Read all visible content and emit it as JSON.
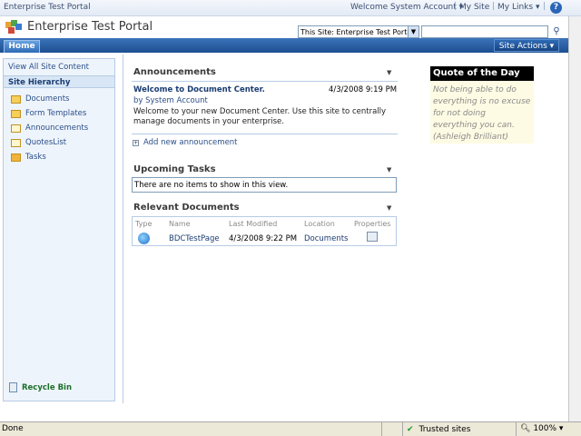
{
  "topbar": {
    "breadcrumb": "Enterprise Test Portal",
    "welcome": "Welcome System Account",
    "my_site": "My Site",
    "my_links": "My Links",
    "help_glyph": "?"
  },
  "header": {
    "site_title": "Enterprise Test Portal",
    "search_scope": "This Site: Enterprise Test Porta",
    "search_value": ""
  },
  "nav": {
    "home_tab": "Home",
    "site_actions": "Site Actions"
  },
  "left_nav": {
    "view_all": "View All Site Content",
    "hierarchy_header": "Site Hierarchy",
    "items": [
      {
        "label": "Documents",
        "icon": "library-icon"
      },
      {
        "label": "Form Templates",
        "icon": "library-icon"
      },
      {
        "label": "Announcements",
        "icon": "list-icon"
      },
      {
        "label": "QuotesList",
        "icon": "list-icon"
      },
      {
        "label": "Tasks",
        "icon": "task-icon"
      }
    ],
    "recycle_bin": "Recycle Bin"
  },
  "announcements": {
    "title": "Announcements",
    "item_title": "Welcome to Document Center.",
    "item_date": "4/3/2008 9:19 PM",
    "item_by": "by System Account",
    "item_body": "Welcome to your new Document Center. Use this site to centrally manage documents in your enterprise.",
    "add_new": "Add new announcement"
  },
  "tasks": {
    "title": "Upcoming Tasks",
    "empty_message": "There are no items to show in this view."
  },
  "documents": {
    "title": "Relevant Documents",
    "columns": [
      "Type",
      "Name",
      "Last Modified",
      "Location",
      "Properties"
    ],
    "rows": [
      {
        "name": "BDCTestPage",
        "modified": "4/3/2008 9:22 PM",
        "location": "Documents"
      }
    ]
  },
  "quote": {
    "title": "Quote of the Day",
    "text": "Not being able to do everything is no excuse for not doing everything you can. (Ashleigh Brilliant)"
  },
  "statusbar": {
    "status": "Done",
    "zone": "Trusted sites",
    "zoom": "100%"
  }
}
